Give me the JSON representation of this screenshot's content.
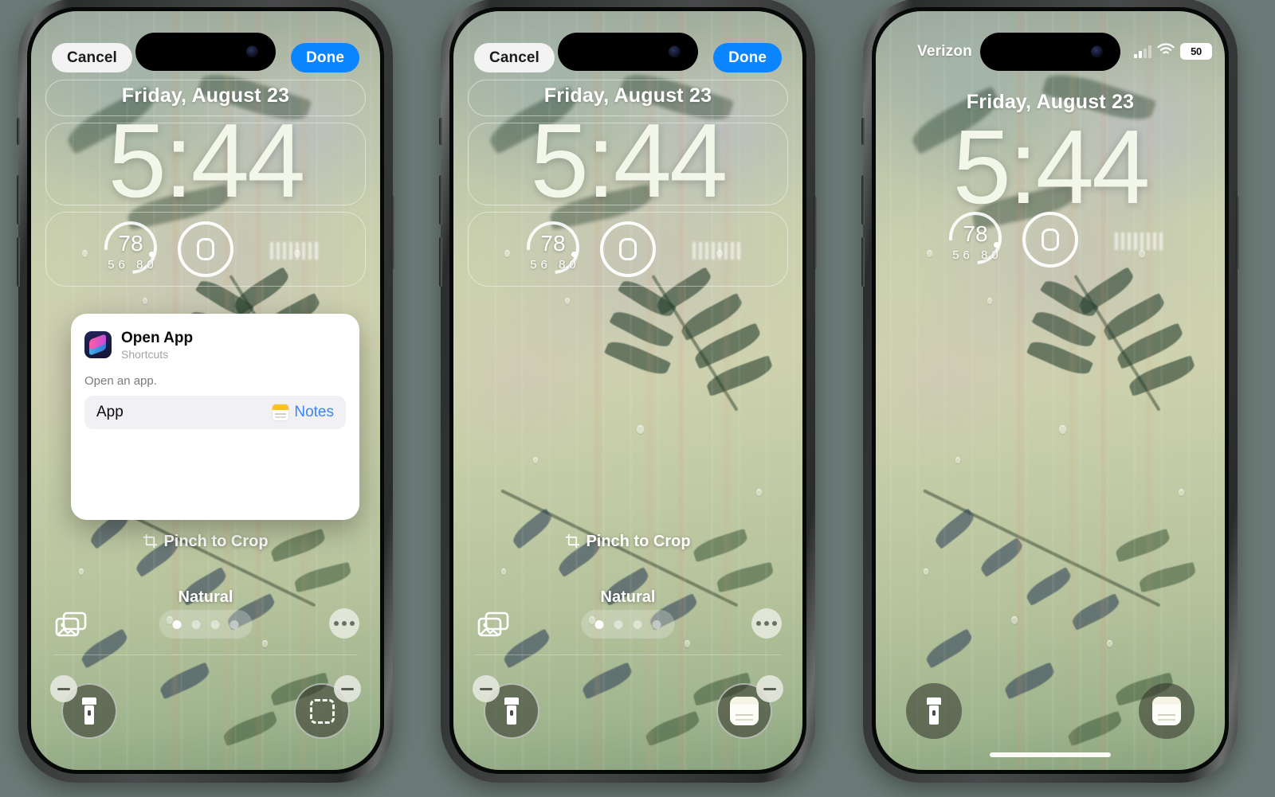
{
  "background_color": "#6b7a76",
  "lockscreen": {
    "date": "Friday, August 23",
    "time": "5:44",
    "pinch_hint": "Pinch to Crop",
    "filter_name": "Natural",
    "widgets": {
      "weather_temp": "78",
      "weather_low": "56",
      "weather_high": "80"
    },
    "page_dots_count": 4,
    "active_dot": 1
  },
  "edit_toolbar": {
    "cancel_label": "Cancel",
    "done_label": "Done"
  },
  "status_bar": {
    "carrier": "Verizon",
    "battery_percent": "50",
    "silent_mode": true
  },
  "dialog": {
    "title": "Open App",
    "subtitle": "Shortcuts",
    "description": "Open an app.",
    "row_label": "App",
    "row_value": "Notes",
    "accent_color": "#3a84f7"
  },
  "phones": [
    {
      "id": "phone-1",
      "mode": "edit",
      "right_action": "empty-placeholder"
    },
    {
      "id": "phone-2",
      "mode": "edit",
      "right_action": "notes"
    },
    {
      "id": "phone-3",
      "mode": "locked",
      "right_action": "notes"
    }
  ],
  "icons": {
    "shortcuts": "shortcuts-icon",
    "notes": "notes-icon",
    "flashlight": "flashlight-icon",
    "photos": "photos-icon",
    "more": "more-options-icon",
    "crop": "crop-icon",
    "bell_slash": "bell-slash-icon",
    "wifi": "wifi-icon",
    "cellular": "cellular-signal-icon",
    "battery": "battery-icon"
  }
}
